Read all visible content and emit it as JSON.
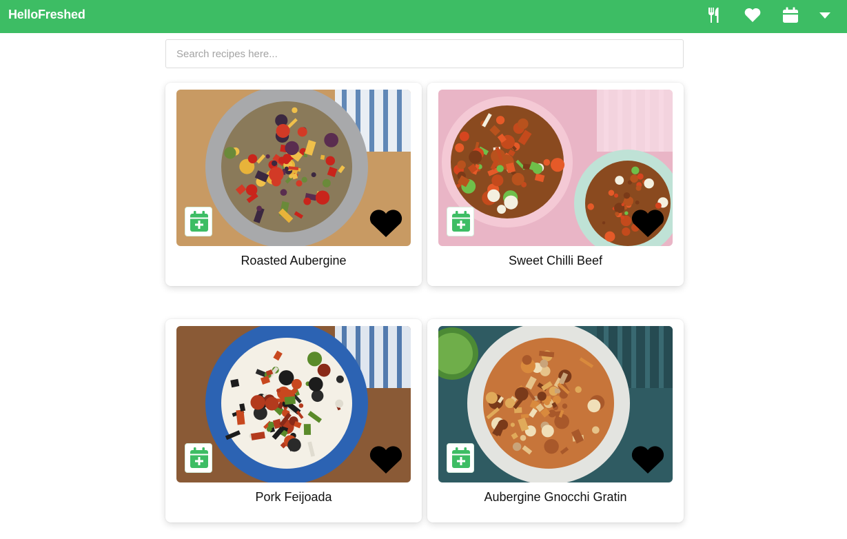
{
  "app": {
    "brand": "HelloFreshed",
    "accent": "#3dbd64"
  },
  "nav": {
    "icons": [
      "utensils-icon",
      "heart-icon",
      "calendar-icon",
      "caret-down-icon"
    ]
  },
  "search": {
    "placeholder": "Search recipes here...",
    "value": ""
  },
  "recipes": [
    {
      "title": "Roasted Aubergine"
    },
    {
      "title": "Sweet Chilli Beef"
    },
    {
      "title": "Pork Feijoada"
    },
    {
      "title": "Aubergine Gnocchi Gratin"
    }
  ]
}
